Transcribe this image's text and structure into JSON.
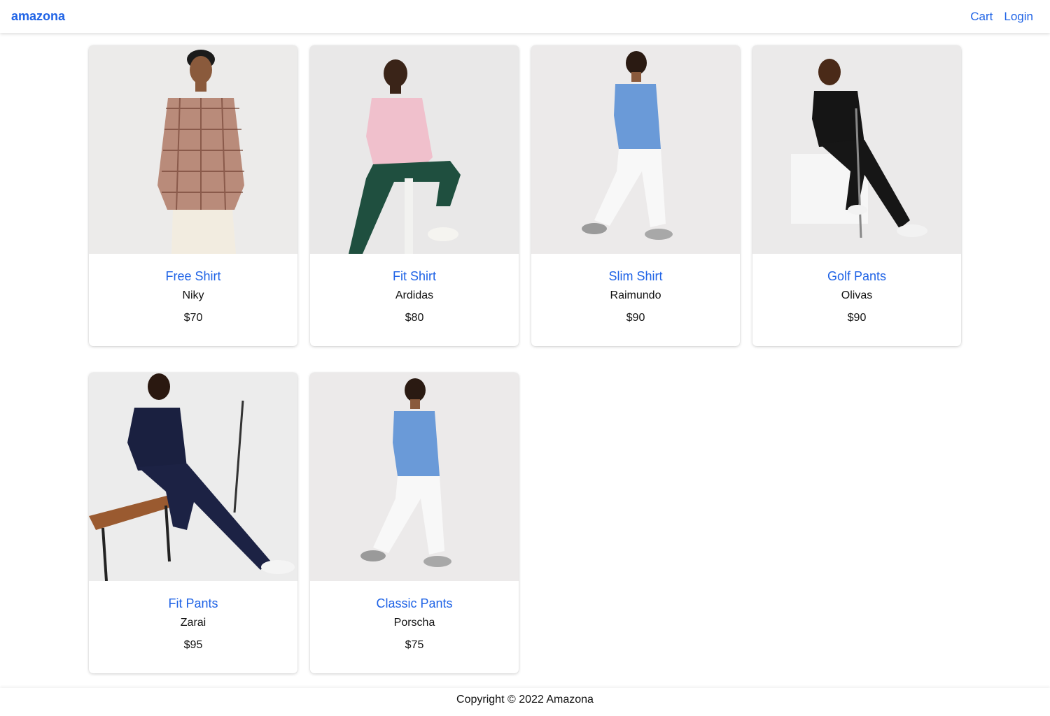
{
  "header": {
    "brand": "amazona",
    "nav": {
      "cart": "Cart",
      "login": "Login"
    }
  },
  "products": [
    {
      "name": "Free Shirt",
      "brand": "Niky",
      "price": "$70",
      "image": "man-plaid-shirt-photo"
    },
    {
      "name": "Fit Shirt",
      "brand": "Ardidas",
      "price": "$80",
      "image": "man-pink-shirt-seated-photo"
    },
    {
      "name": "Slim Shirt",
      "brand": "Raimundo",
      "price": "$90",
      "image": "man-blue-tshirt-walking-photo"
    },
    {
      "name": "Golf Pants",
      "brand": "Olivas",
      "price": "$90",
      "image": "man-black-polo-golf-photo"
    },
    {
      "name": "Fit Pants",
      "brand": "Zarai",
      "price": "$95",
      "image": "man-navy-polo-bench-photo"
    },
    {
      "name": "Classic Pants",
      "brand": "Porscha",
      "price": "$75",
      "image": "man-blue-tshirt-walking-photo"
    }
  ],
  "footer": {
    "copyright": "Copyright © 2022 Amazona"
  },
  "colors": {
    "link": "#1f63e6",
    "photo_bg": "#ebeaea"
  }
}
